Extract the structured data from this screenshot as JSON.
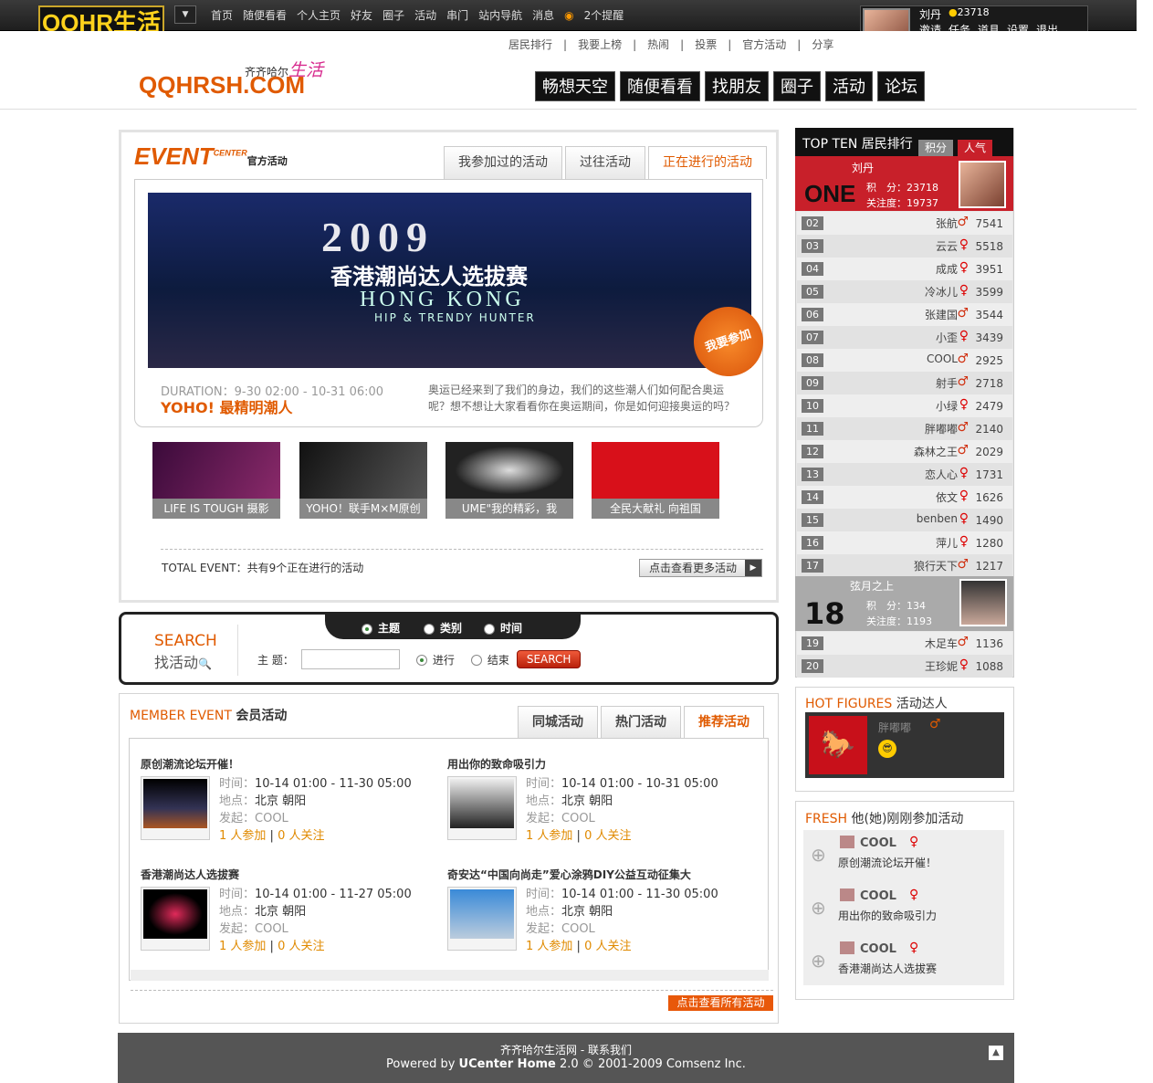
{
  "topbar": {
    "brand": "QQHR生活",
    "nav": [
      "首页",
      "随便看看",
      "个人主页",
      "好友",
      "圈子",
      "活动",
      "串门",
      "站内导航",
      "消息",
      "2个提醒"
    ],
    "user": {
      "name": "刘丹",
      "points": "23718",
      "links": [
        "邀请",
        "任务",
        "道具",
        "设置",
        "退出"
      ]
    }
  },
  "header": {
    "subnav": [
      "居民排行",
      "|",
      "我要上榜",
      "|",
      "热闹",
      "|",
      "投票",
      "|",
      "官方活动",
      "|",
      "分享"
    ],
    "logo": "QQHRSH.COM",
    "logo_sub": "齐齐哈尔",
    "logo_sub2": "生活",
    "mainnav": [
      "畅想天空",
      "随便看看",
      "找朋友",
      "圈子",
      "活动",
      "论坛"
    ]
  },
  "event": {
    "title": "EVENT",
    "title_sup": "CENTER",
    "title_cn": "官方活动",
    "tabs": [
      "我参加过的活动",
      "过往活动",
      "正在进行的活动"
    ],
    "banner": {
      "year": "2009",
      "title": "香港潮尚达人选拔赛",
      "en1": "HONG KONG",
      "en2": "HIP & TRENDY HUNTER"
    },
    "join": "我要参加",
    "duration": "DURATION：9-30 02:00 - 10-31 06:00",
    "headline": "YOHO! 最精明潮人",
    "description": "奥运已经来到了我们的身边，我们的这些潮人们如何配合奥运呢？想不想让大家看看你在奥运期间，你是如何迎接奥运的吗？",
    "thumbs": [
      "LIFE IS TOUGH 摄影",
      "YOHO！联手M×M原创",
      "UME\"我的精彩，我",
      "全民大献礼 向祖国"
    ],
    "total": "TOTAL EVENT：共有9个正在进行的活动",
    "more": "点击查看更多活动"
  },
  "search": {
    "label_en": "SEARCH",
    "label_cn": "找活动",
    "options": [
      "主题",
      "类别",
      "时间"
    ],
    "field_label": "主 题：",
    "status": [
      "进行",
      "结束"
    ],
    "button": "SEARCH"
  },
  "member": {
    "title_en": "MEMBER EVENT",
    "title_cn": "会员活动",
    "tabs": [
      "同城活动",
      "热门活动",
      "推荐活动"
    ],
    "items": [
      {
        "title": "原创潮流论坛开催！",
        "time": "10-14 01:00 - 11-30 05:00",
        "place": "北京 朝阳",
        "by": "COOL",
        "joined": "1 人参加",
        "follow": "0 人关注"
      },
      {
        "title": "用出你的致命吸引力",
        "time": "10-14 01:00 - 10-31 05:00",
        "place": "北京 朝阳",
        "by": "COOL",
        "joined": "1 人参加",
        "follow": "0 人关注"
      },
      {
        "title": "香港潮尚达人选拔赛",
        "time": "10-14 01:00 - 11-27 05:00",
        "place": "北京 朝阳",
        "by": "COOL",
        "joined": "1 人参加",
        "follow": "0 人关注"
      },
      {
        "title": "奇安达“中国向尚走”爱心涂鸦DIY公益互动征集大",
        "time": "10-14 01:00 - 11-30 05:00",
        "place": "北京 朝阳",
        "by": "COOL",
        "joined": "1 人参加",
        "follow": "0 人关注"
      }
    ],
    "labels": {
      "time": "时间：",
      "place": "地点：",
      "by": "发起："
    },
    "all": "点击查看所有活动"
  },
  "ranking": {
    "title": "TOP TEN 居民排行",
    "tabs": [
      "积分",
      "人气"
    ],
    "first": {
      "word": "ONE",
      "name": "刘丹",
      "score": "积　分：23718",
      "popularity": "关注度：19737"
    },
    "rows": [
      {
        "n": "02",
        "name": "张航",
        "g": "♂",
        "s": "7541"
      },
      {
        "n": "03",
        "name": "云云",
        "g": "♀",
        "s": "5518"
      },
      {
        "n": "04",
        "name": "成成",
        "g": "♀",
        "s": "3951"
      },
      {
        "n": "05",
        "name": "冷冰儿",
        "g": "♀",
        "s": "3599"
      },
      {
        "n": "06",
        "name": "张建国",
        "g": "♂",
        "s": "3544"
      },
      {
        "n": "07",
        "name": "小歪",
        "g": "♀",
        "s": "3439"
      },
      {
        "n": "08",
        "name": "COOL",
        "g": "♂",
        "s": "2925"
      },
      {
        "n": "09",
        "name": "射手",
        "g": "♂",
        "s": "2718"
      },
      {
        "n": "10",
        "name": "小绿",
        "g": "♀",
        "s": "2479"
      },
      {
        "n": "11",
        "name": "胖嘟嘟",
        "g": "♂",
        "s": "2140"
      },
      {
        "n": "12",
        "name": "森林之王",
        "g": "♂",
        "s": "2029"
      },
      {
        "n": "13",
        "name": "恋人心",
        "g": "♀",
        "s": "1731"
      },
      {
        "n": "14",
        "name": "依文",
        "g": "♀",
        "s": "1626"
      },
      {
        "n": "15",
        "name": "benben",
        "g": "♀",
        "s": "1490"
      },
      {
        "n": "16",
        "name": "萍儿",
        "g": "♀",
        "s": "1280"
      },
      {
        "n": "17",
        "name": "狼行天下",
        "g": "♂",
        "s": "1217"
      }
    ],
    "self": {
      "n": "18",
      "name": "弦月之上",
      "score": "积　分：134",
      "popularity": "关注度：1193"
    },
    "rows2": [
      {
        "n": "19",
        "name": "木足车",
        "g": "♂",
        "s": "1136"
      },
      {
        "n": "20",
        "name": "王珍妮",
        "g": "♀",
        "s": "1088"
      }
    ]
  },
  "hot": {
    "title_en": "HOT FIGURES",
    "title_cn": "活动达人",
    "name": "胖嘟嘟",
    "g": "♂"
  },
  "fresh": {
    "title_en": "FRESH",
    "title_cn": "他(她)刚刚参加活动",
    "items": [
      {
        "user": "COOL",
        "g": "♀",
        "event": "原创潮流论坛开催！"
      },
      {
        "user": "COOL",
        "g": "♀",
        "event": "用出你的致命吸引力"
      },
      {
        "user": "COOL",
        "g": "♀",
        "event": "香港潮尚达人选拔赛"
      }
    ]
  },
  "footer": {
    "line1": "齐齐哈尔生活网 - 联系我们",
    "line2": "Powered by",
    "brand": "UCenter Home",
    "line3": "2.0 © 2001-2009 Comsenz Inc."
  }
}
